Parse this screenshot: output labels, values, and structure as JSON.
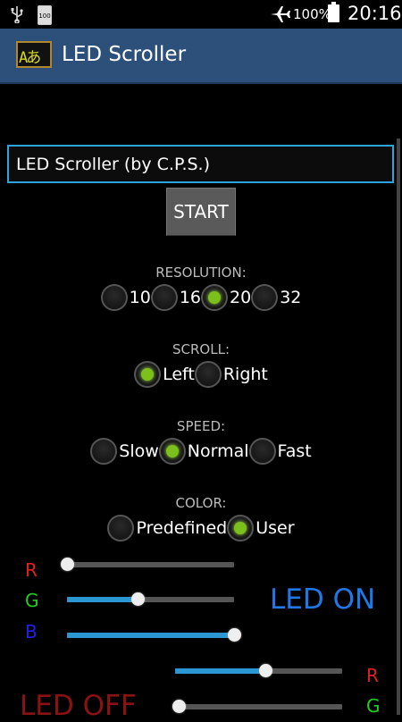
{
  "status_bar": {
    "battery_small": "100",
    "battery_pct": "100%",
    "time": "20:16",
    "icons": [
      "usb-icon",
      "battery-small-icon",
      "airplane-icon",
      "battery-icon"
    ]
  },
  "app": {
    "title": "LED Scroller",
    "logo_text": "Aあ"
  },
  "text_input": {
    "value": "LED Scroller (by C.P.S.)"
  },
  "start_label": "START",
  "resolution": {
    "label": "RESOLUTION:",
    "options": [
      "10",
      "16",
      "20",
      "32"
    ],
    "selected": "20"
  },
  "scroll": {
    "label": "SCROLL:",
    "options": [
      "Left",
      "Right"
    ],
    "selected": "Left"
  },
  "speed": {
    "label": "SPEED:",
    "options": [
      "Slow",
      "Normal",
      "Fast"
    ],
    "selected": "Normal"
  },
  "color": {
    "label": "COLOR:",
    "options": [
      "Predefined",
      "User"
    ],
    "selected": "User"
  },
  "led_on": {
    "label": "LED ON",
    "channels": [
      {
        "name": "R",
        "color": "#e02020",
        "value": 0
      },
      {
        "name": "G",
        "color": "#20d020",
        "value": 0.42
      },
      {
        "name": "B",
        "color": "#2020e8",
        "value": 1.0
      }
    ]
  },
  "led_off": {
    "label": "LED OFF",
    "channels": [
      {
        "name": "R",
        "color": "#e02020",
        "value": 0.54
      },
      {
        "name": "G",
        "color": "#20d020",
        "value": 0.02
      }
    ]
  },
  "colors": {
    "accent": "#2b98d3",
    "radio_on": "#7cc11b",
    "actionbar": "#2c5079"
  }
}
